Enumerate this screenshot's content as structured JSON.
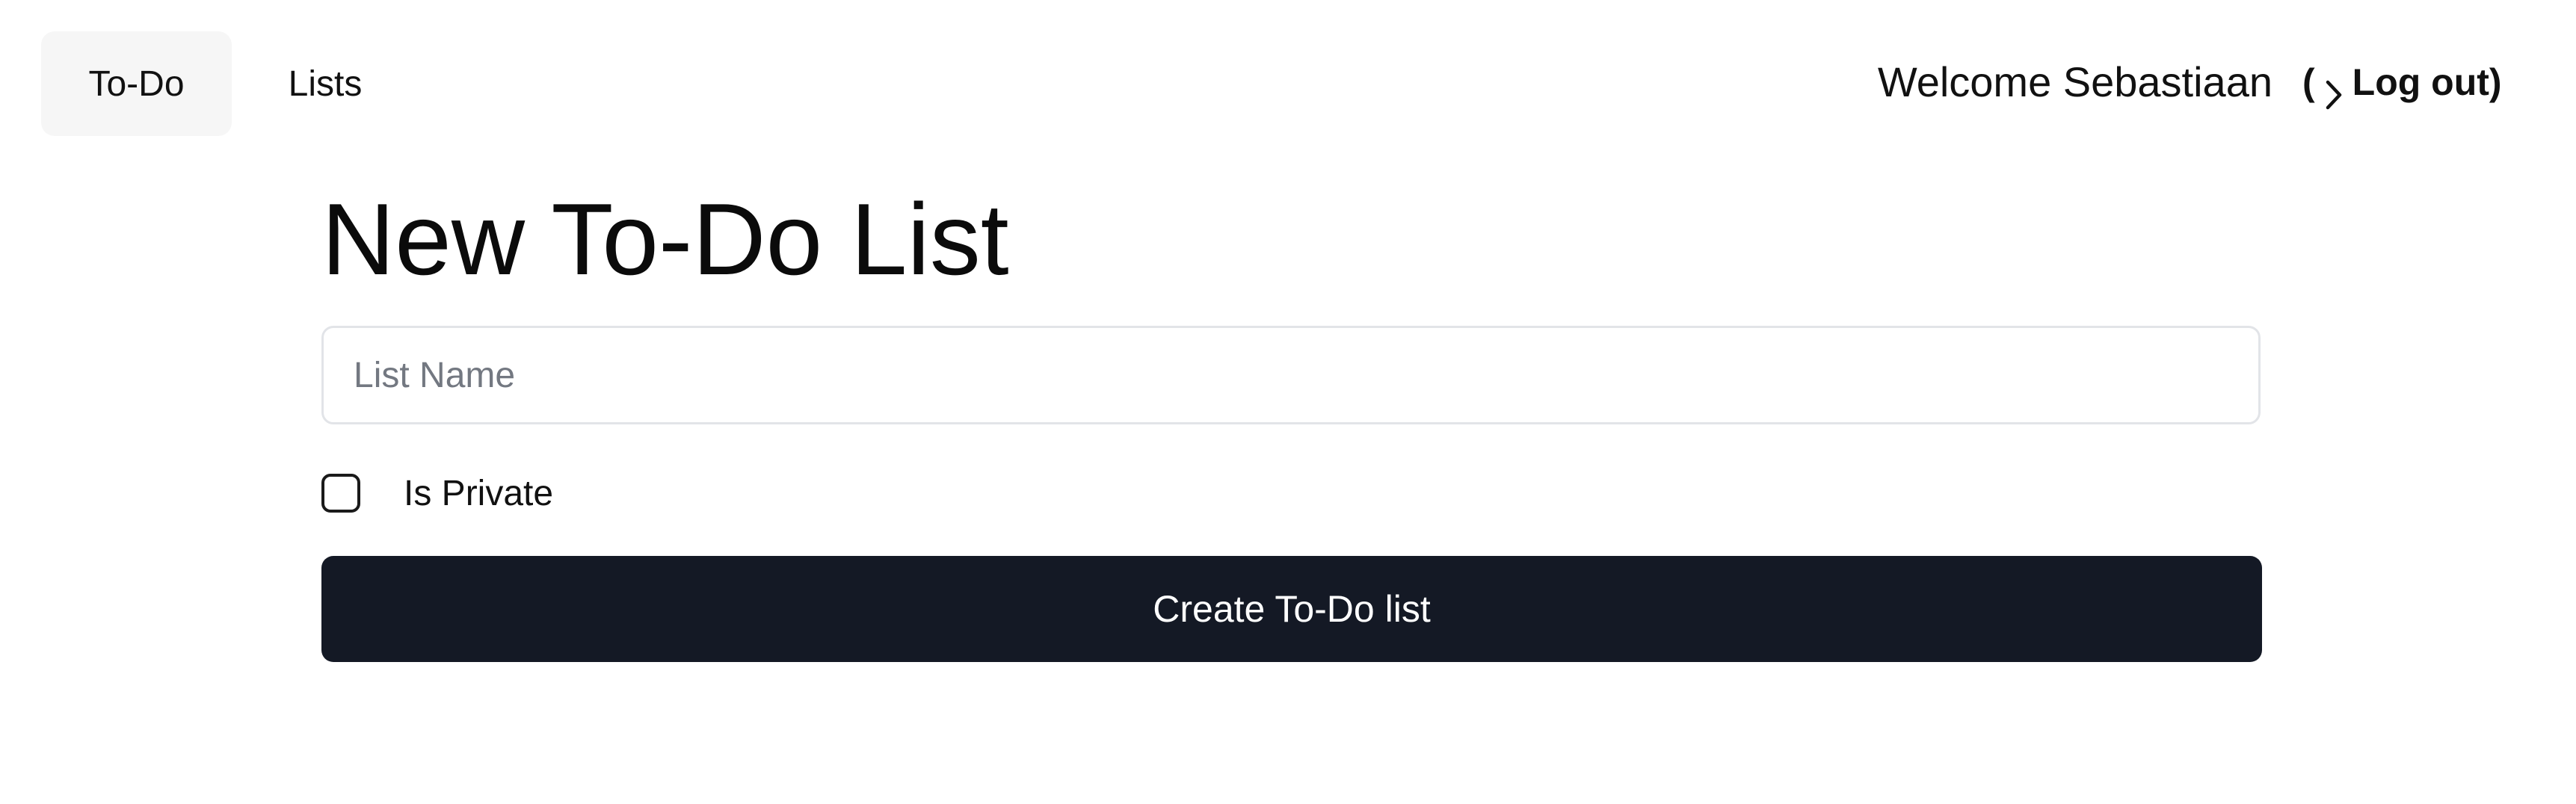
{
  "nav": {
    "items": [
      {
        "label": "To-Do",
        "active": true
      },
      {
        "label": "Lists",
        "active": false
      }
    ],
    "welcome_text": "Welcome Sebastiaan",
    "logout": {
      "open_paren": "(",
      "icon": "chevron-right-icon",
      "label": "Log out)"
    }
  },
  "form": {
    "title": "New To-Do List",
    "name_input": {
      "value": "",
      "placeholder": "List Name"
    },
    "private_checkbox": {
      "label": "Is Private",
      "checked": false
    },
    "submit_label": "Create To-Do list"
  },
  "colors": {
    "button_bg": "#141925",
    "active_nav_bg": "#f6f6f6",
    "input_border": "#e2e4e8",
    "placeholder": "#737881"
  }
}
